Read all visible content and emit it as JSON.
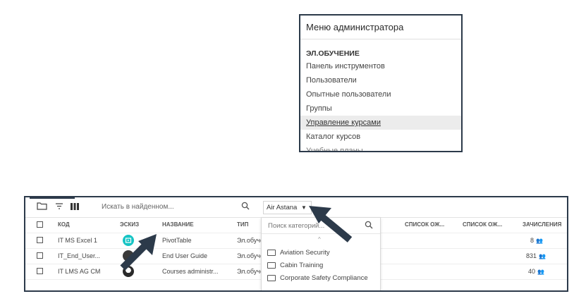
{
  "admin_menu": {
    "title": "Меню администратора",
    "section": "ЭЛ.ОБУЧЕНИЕ",
    "items": [
      {
        "label": "Панель инструментов"
      },
      {
        "label": "Пользователи"
      },
      {
        "label": "Опытные пользователи"
      },
      {
        "label": "Группы"
      },
      {
        "label": "Управление курсами"
      },
      {
        "label": "Каталог курсов"
      },
      {
        "label": "Учебные планы"
      }
    ],
    "active_item": "Управление курсами"
  },
  "toolbar": {
    "search_placeholder": "Искать в найденном...",
    "company_select": "Air Astana"
  },
  "table": {
    "headers": [
      "КОД",
      "ЭСКИЗ",
      "НАЗВАНИЕ",
      "ТИП",
      "СПИСОК ОЖ...",
      "СПИСОК ОЖ...",
      "ЗАЧИСЛЕНИЯ"
    ],
    "rows": [
      {
        "code": "IT MS Excel 1",
        "name": "PivotTable",
        "type": "Эл.обуче",
        "enrollments": "8"
      },
      {
        "code": "IT_End_User...",
        "name": "End User Guide",
        "type": "Эл.обуче",
        "enrollments": "831"
      },
      {
        "code": "IT LMS AG CM",
        "name": "Courses administr...",
        "type": "Эл.обуче",
        "enrollments": "40"
      }
    ]
  },
  "category_dropdown": {
    "placeholder": "Поиск категорий...",
    "categories": [
      "Aviation Security",
      "Cabin Training",
      "Corporate Safety Compliance"
    ]
  },
  "colors": {
    "border_dark": "#2c3a4a",
    "thumb_teal": "#16c4c4",
    "arrow": "#2c3a4a"
  }
}
